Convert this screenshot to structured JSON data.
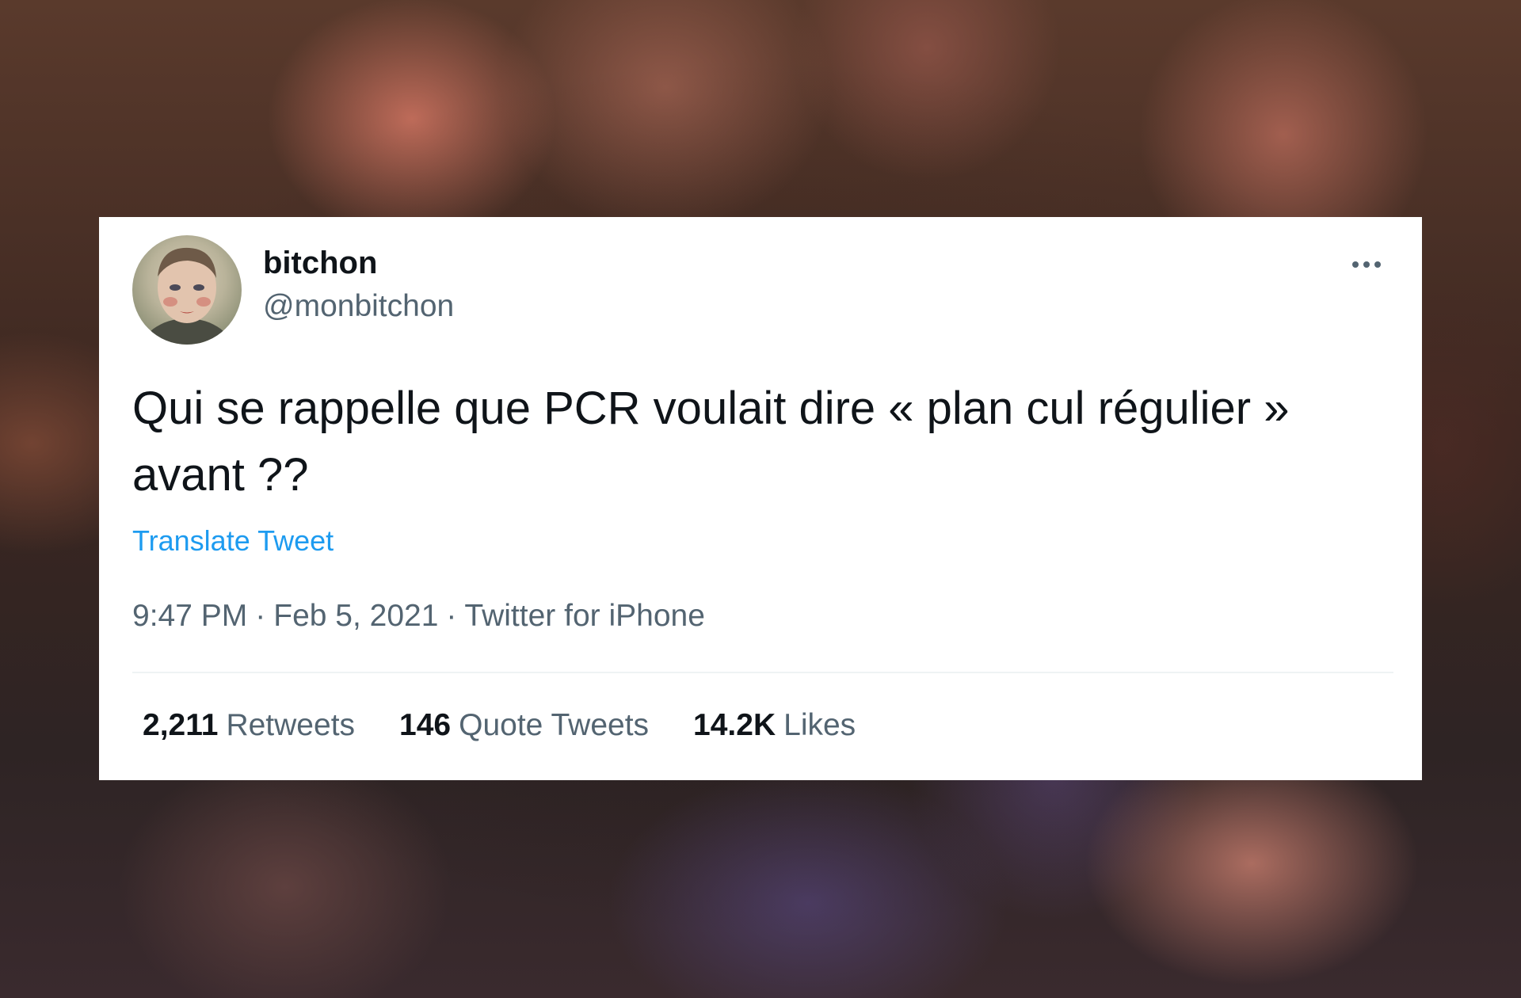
{
  "tweet": {
    "display_name": "bitchon",
    "handle": "@monbitchon",
    "text": "Qui se rappelle que PCR voulait dire « plan cul régulier » avant ??",
    "translate_label": "Translate Tweet",
    "time": "9:47 PM",
    "separator": "·",
    "date": "Feb 5, 2021",
    "source": "Twitter for iPhone",
    "more_icon": "more-horizontal-icon",
    "stats": {
      "retweets_count": "2,211",
      "retweets_label": "Retweets",
      "quotes_count": "146",
      "quotes_label": "Quote Tweets",
      "likes_count": "14.2K",
      "likes_label": "Likes"
    }
  },
  "colors": {
    "primary_text": "#0f1419",
    "secondary_text": "#536471",
    "link": "#1d9bf0",
    "divider": "#eff3f4",
    "card_background": "#ffffff"
  }
}
